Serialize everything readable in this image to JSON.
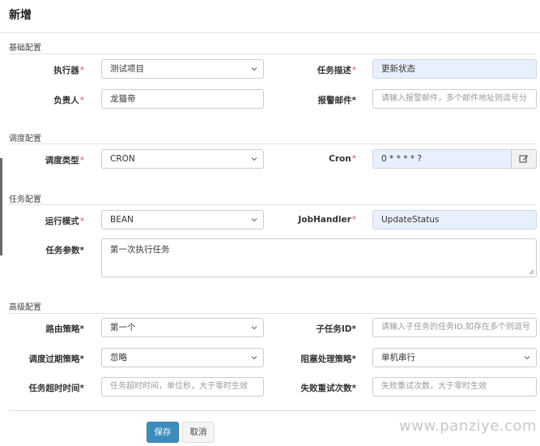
{
  "modal": {
    "title": "新增"
  },
  "sections": {
    "basic": "基础配置",
    "schedule": "调度配置",
    "task": "任务配置",
    "advanced": "高级配置"
  },
  "fields": {
    "executor": {
      "label": "执行器",
      "value": "测试项目"
    },
    "job_desc": {
      "label": "任务描述",
      "value": "更新状态"
    },
    "author": {
      "label": "负责人",
      "value": "龙猫帝"
    },
    "alarm_email": {
      "label": "报警邮件",
      "placeholder": "请输入报警邮件，多个邮件地址则逗号分"
    },
    "schedule_type": {
      "label": "调度类型",
      "value": "CRON"
    },
    "cron": {
      "label": "Cron",
      "value": "0 * * * * ?"
    },
    "run_mode": {
      "label": "运行模式",
      "value": "BEAN"
    },
    "job_handler": {
      "label": "JobHandler",
      "value": "UpdateStatus"
    },
    "job_param": {
      "label": "任务参数",
      "value": "第一次执行任务"
    },
    "route_strategy": {
      "label": "路由策略",
      "value": "第一个"
    },
    "child_job_id": {
      "label": "子任务ID",
      "placeholder": "请输入子任务的任务ID,如存在多个则逗号"
    },
    "misfire_strategy": {
      "label": "调度过期策略",
      "value": "忽略"
    },
    "block_strategy": {
      "label": "阻塞处理策略",
      "value": "单机串行"
    },
    "timeout": {
      "label": "任务超时时间",
      "placeholder": "任务超时时间，单位秒，大于零时生效"
    },
    "fail_retry": {
      "label": "失败重试次数",
      "placeholder": "失败重试次数，大于零时生效"
    }
  },
  "required_marker": "*",
  "buttons": {
    "save": "保存",
    "cancel": "取消"
  },
  "watermark": "www.panziye.com",
  "colors": {
    "primary": "#3c8dbc",
    "required": "#d9534f",
    "filled_bg": "#e8f0fe"
  }
}
